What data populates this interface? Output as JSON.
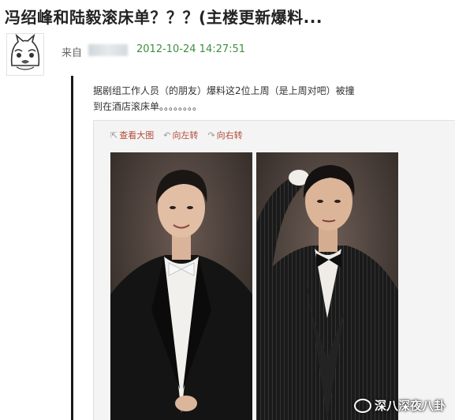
{
  "post": {
    "title": "冯绍峰和陆毅滚床单？？？(主楼更新爆料...",
    "from_label": "来自",
    "timestamp": "2012-10-24 14:27:51",
    "body": "据剧组工作人员（的朋友）爆料这2位上周（是上周对吧）被撞到在酒店滚床单。。。。。。。。"
  },
  "image_toolbar": {
    "view_large": "查看大图",
    "rotate_left": "向左转",
    "rotate_right": "向右转"
  },
  "watermark": {
    "text": "深八深夜八卦",
    "icon": "wechat-icon"
  },
  "icons": {
    "view_large": "zoom-icon",
    "rotate_left": "rotate-left-icon",
    "rotate_right": "rotate-right-icon"
  },
  "colors": {
    "timestamp": "#3f8f3f",
    "toolbar_link": "#b34a36",
    "title": "#222222"
  }
}
